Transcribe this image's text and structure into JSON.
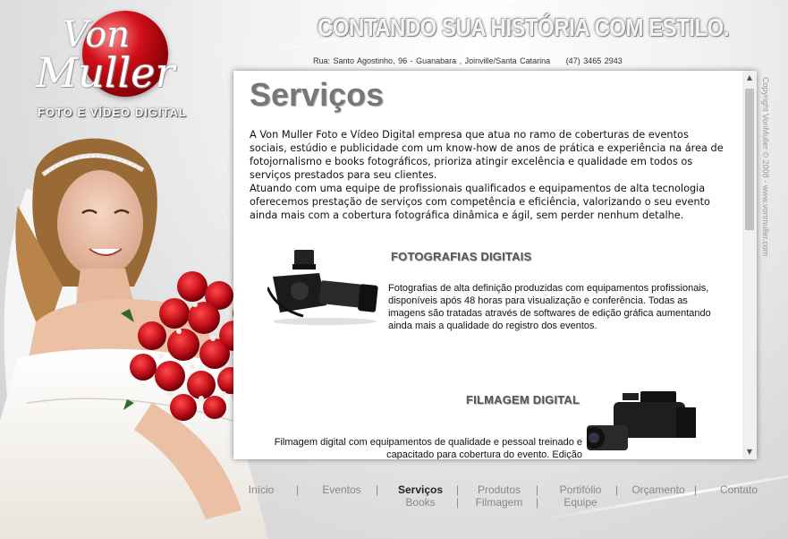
{
  "logo": {
    "line1": "Von",
    "line2": "Muller",
    "subtitle": "FOTO E VÍDEO DIGITAL"
  },
  "header": {
    "tagline": "CONTANDO SUA HISTÓRIA COM ESTILO.",
    "address": "Rua: Santo Agostinho, 96 - Guanabara , Joinville/Santa Catarina",
    "phone": "(47) 3465 2943"
  },
  "content": {
    "title": "Serviços",
    "intro_p1": "A Von Muller Foto e Vídeo Digital empresa que atua no ramo de coberturas de eventos sociais, estúdio e publicidade com um know-how de anos de prática e experiência na área de fotojornalismo e books fotográficos, prioriza atingir excelência e qualidade em todos os serviços prestados para seu clientes.",
    "intro_p2": "Atuando com uma equipe de profissionais qualificados e equipamentos de alta tecnologia oferecemos prestação de serviços com competência e eficiência, valorizando o seu evento ainda mais com a cobertura fotográfica dinâmica e ágil, sem perder nenhum detalhe.",
    "services": [
      {
        "title": "FOTOGRAFIAS DIGITAIS",
        "text": "Fotografias de alta definição produzidas com equipamentos profissionais, disponíveis após 48 horas para visualização e conferência. Todas as imagens são tratadas através de softwares de edição gráfica aumentando ainda mais a qualidade do registro dos eventos."
      },
      {
        "title": "FILMAGEM DIGITAL",
        "text": "Filmagem digital com equipamentos de qualidade e pessoal treinado e capacitado para cobertura do evento. Edição"
      }
    ]
  },
  "copyright": "Copyright VonMuller © 2008 - www.vonmuller.com",
  "nav": {
    "items": [
      "Início",
      "Eventos",
      "Serviços",
      "Produtos",
      "Portifólio",
      "Orçamento",
      "Contato",
      "Books",
      "Filmagem",
      "Equipe"
    ],
    "separator": "|",
    "active": "Serviços"
  },
  "colors": {
    "logo_red": "#c8101a",
    "title_gray": "#777777",
    "nav_gray": "#888888"
  }
}
